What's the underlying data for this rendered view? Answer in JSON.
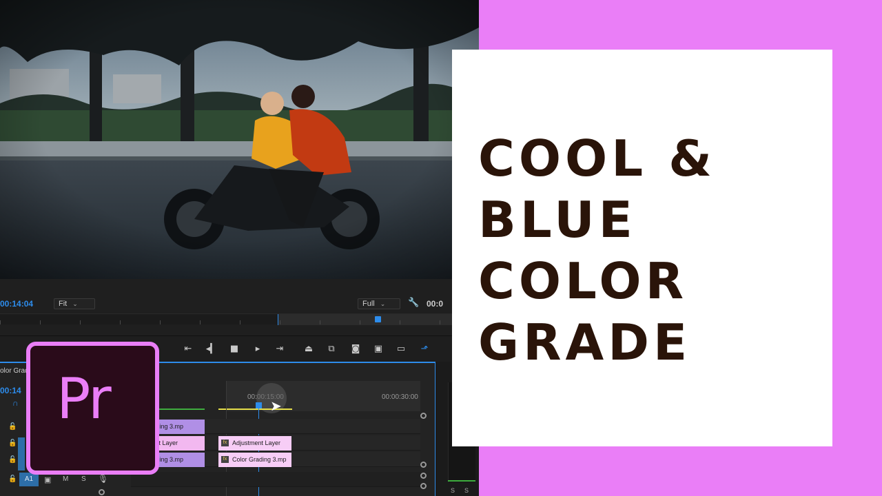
{
  "colors": {
    "pink_frame": "#ea7ef7",
    "card": "#ffffff",
    "title_text": "#2a1409",
    "accent_blue": "#2d8ceb",
    "logo_bg": "#2a0b1a"
  },
  "title_lines": [
    "COOL &",
    "BLUE",
    "COLOR",
    "GRADE"
  ],
  "monitor": {
    "timecode": "00:14:04",
    "fit_label": "Fit",
    "quality_label": "Full",
    "timecode_right": "00:0"
  },
  "timeline": {
    "sequence_name": "olor Grad",
    "timecode": "00:14",
    "ruler_mid": "00:00:15:00",
    "ruler_end": "00:00:30:00",
    "track_a1": "A1",
    "track_m": "M",
    "track_s": "S",
    "meter_s1": "S",
    "meter_s2": "S",
    "clips": {
      "v3_left": "olor Grading 3.mp",
      "v2_left": "djustment Layer",
      "v1_left": "olor Grading 3.mp",
      "v2_right": "Adjustment Layer",
      "v1_right": "Color Grading 3.mp",
      "fx": "fx"
    }
  },
  "logo_text": "Pr",
  "icons": {
    "transport": [
      "mark-in-icon",
      "step-back-icon",
      "stop-icon",
      "play-icon",
      "go-to-out-icon",
      "lift-icon",
      "extract-icon",
      "camera-icon",
      "compare-icon",
      "safe-margins-icon",
      "export-icon"
    ],
    "wrench": "wrench-icon",
    "cursor": "cursor-icon"
  }
}
